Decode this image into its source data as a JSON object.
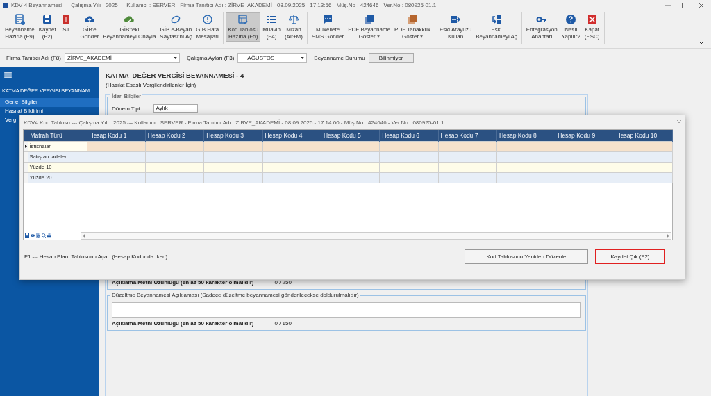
{
  "window": {
    "title": "KDV 4 Beyannamesi  ---  Çalışma Yılı : 2025  ---  Kullanıcı : SERVER - Firma Tanıtıcı Adı : ZİRVE_AKADEMİ - 08.09.2025 - 17:13:56 - Müş.No : 424646 - Ver.No : 080925-01.1"
  },
  "ribbon": {
    "groups": [
      {
        "buttons": [
          {
            "kind": "document",
            "label": "Beyanname\nHazırla (F9)",
            "selected": false,
            "dropdown": false
          },
          {
            "kind": "save",
            "label": "Kaydet\n(F2)",
            "selected": false,
            "dropdown": false
          },
          {
            "kind": "delete",
            "label": "Sil",
            "selected": false,
            "dropdown": false
          }
        ]
      },
      {
        "buttons": [
          {
            "kind": "upload",
            "label": "GİB'e\nGönder",
            "selected": false,
            "dropdown": false
          },
          {
            "kind": "approve",
            "label": "GİB'teki\nBeyannameyi Onayla",
            "selected": false,
            "dropdown": false
          },
          {
            "kind": "web",
            "label": "GİB e-Beyan\nSayfası'nı Aç",
            "selected": false,
            "dropdown": false
          },
          {
            "kind": "alert",
            "label": "GİB Hata\nMesajları",
            "selected": false,
            "dropdown": false
          }
        ]
      },
      {
        "buttons": [
          {
            "kind": "table",
            "label": "Kod Tablosu\nHazırla (F5)",
            "selected": true,
            "dropdown": false
          },
          {
            "kind": "list",
            "label": "Muavin\n(F4)",
            "selected": false,
            "dropdown": false
          },
          {
            "kind": "scale",
            "label": "Mizan\n(Alt+M)",
            "selected": false,
            "dropdown": false
          }
        ]
      },
      {
        "buttons": [
          {
            "kind": "chat",
            "label": "Mükellefe\nSMS Gönder",
            "selected": false,
            "dropdown": false
          },
          {
            "kind": "pdf",
            "label": "PDF Beyanname\nGöster",
            "selected": false,
            "dropdown": true
          },
          {
            "kind": "pdf2",
            "label": "PDF Tahakkuk\nGöster",
            "selected": false,
            "dropdown": true
          }
        ]
      },
      {
        "buttons": [
          {
            "kind": "arrows",
            "label": "Eski Arayüzü\nKullan",
            "selected": false,
            "dropdown": false
          },
          {
            "kind": "swap",
            "label": "Eski\nBeyannameyi Aç",
            "selected": false,
            "dropdown": false
          }
        ]
      },
      {
        "buttons": [
          {
            "kind": "key",
            "label": "Entegrasyon\nAnahtarı",
            "selected": false,
            "dropdown": false
          },
          {
            "kind": "help",
            "label": "Nasıl\nYapılır?",
            "selected": false,
            "dropdown": false
          },
          {
            "kind": "close",
            "label": "Kapat\n(ESC)",
            "selected": false,
            "dropdown": false
          }
        ]
      }
    ]
  },
  "filters": {
    "company_label": "Firma Tanıtıcı Adı (F8)",
    "company": "ZİRVE_AKADEMİ",
    "months_label": "Çalışma Ayları (F3)",
    "month": "AĞUSTOS",
    "status_label": "Beyanname Durumu",
    "status": "Bilinmiyor"
  },
  "sidebar": {
    "title": "KATMA  DEĞER VERGİSİ BEYANNAM...",
    "items": [
      {
        "label": "Genel Bilgiler",
        "selected": true
      },
      {
        "label": "Hasılat Bildirimi",
        "selected": false
      },
      {
        "label": "Vergi",
        "selected": false
      }
    ]
  },
  "form": {
    "title": "KATMA  DEĞER VERGİSİ BEYANNAMESİ - 4",
    "subtitle": "(Hasılat Esaslı Vergilendirilenler İçin)",
    "admin": {
      "legend": "İdari Bilgiler",
      "period_label": "Dönem Tipi",
      "period": "Aylık",
      "length_label": "Açıklama Metni Uzunluğu (en az 50 karakter olmalıdır)",
      "length": "0 / 250"
    },
    "correction": {
      "legend": "Düzeltme Beyannamesi Açıklaması (Sadece düzeltme beyannamesi gönderilecekse doldurulmalıdır)",
      "length_label": "Açıklama Metni Uzunluğu (en az 50 karakter olmalıdır)",
      "length": "0 / 150"
    }
  },
  "dialog": {
    "title": "KDV4 Kod Tablosu  ---  Çalışma Yılı : 2025  ---  Kullanıcı : SERVER - Firma Tanıtıcı Adı : ZİRVE_AKADEMİ - 08.09.2025 - 17:14:00 - Müş.No : 424646 - Ver.No : 080925-01.1",
    "table": {
      "columns": [
        "Matrah Türü",
        "Hesap Kodu 1",
        "Hesap Kodu 2",
        "Hesap Kodu 3",
        "Hesap Kodu 4",
        "Hesap Kodu 5",
        "Hesap Kodu 6",
        "Hesap Kodu 7",
        "Hesap Kodu 8",
        "Hesap Kodu 9",
        "Hesap Kodu 10"
      ],
      "rows": [
        {
          "label": "İstisnalar",
          "selected": true
        },
        {
          "label": "Satıştan İadeler",
          "selected": false
        },
        {
          "label": "Yüzde 10",
          "selected": false
        },
        {
          "label": "Yüzde 20",
          "selected": false
        }
      ]
    },
    "hint": "F1 --- Hesap Planı Tablosunu Açar. (Hesap Kodunda İken)",
    "buttons": [
      {
        "label": "Kod Tablosunu Yeniden Düzenle",
        "highlighted": false
      },
      {
        "label": "Kaydet Çık (F2)",
        "highlighted": true
      }
    ]
  }
}
